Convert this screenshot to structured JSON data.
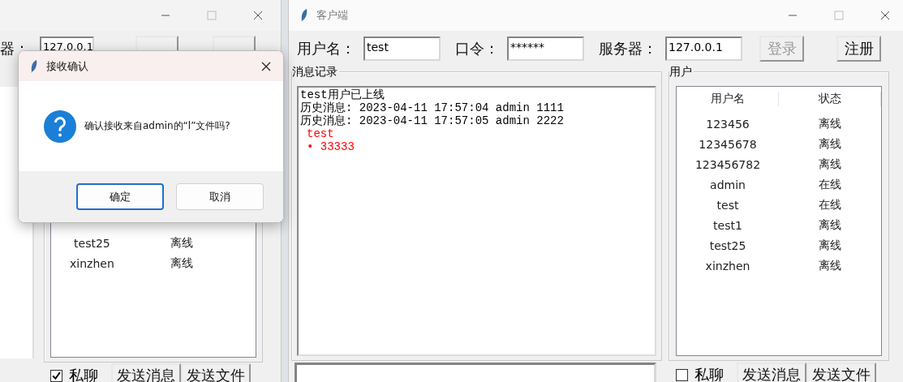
{
  "back_window": {
    "server_label": "器：",
    "server": "127.0.0.1",
    "users": [
      {
        "name": "test25",
        "status": "离线"
      },
      {
        "name": "xinzhen",
        "status": "离线"
      }
    ],
    "private_chat": {
      "label": "私聊",
      "checked": true
    },
    "send_buttons": [
      "发送消息",
      "发送文件"
    ]
  },
  "window": {
    "title": "客户端",
    "fields": [
      {
        "label": "用户名：",
        "value": "test"
      },
      {
        "label": "口令：",
        "value": "******"
      },
      {
        "label": "服务器：",
        "value": "127.0.0.1"
      }
    ],
    "buttons": [
      {
        "label": "登录",
        "disabled": true
      },
      {
        "label": "注册",
        "disabled": false
      }
    ],
    "messages": {
      "title": "消息记录",
      "lines": [
        {
          "text": "test用户已上线",
          "kind": "normal"
        },
        {
          "text": "历史消息: 2023-04-11 17:57:04 admin 1111",
          "kind": "normal"
        },
        {
          "text": "历史消息: 2023-04-11 17:57:05 admin 2222",
          "kind": "normal"
        },
        {
          "text": "test",
          "kind": "incoming"
        },
        {
          "text": "• 33333",
          "kind": "incoming"
        }
      ]
    },
    "users": {
      "title": "用户",
      "columns": [
        "用户名",
        "状态"
      ],
      "rows": [
        {
          "name": "123456",
          "status": "离线"
        },
        {
          "name": "12345678",
          "status": "离线"
        },
        {
          "name": "123456782",
          "status": "离线"
        },
        {
          "name": "admin",
          "status": "在线"
        },
        {
          "name": "test",
          "status": "在线"
        },
        {
          "name": "test1",
          "status": "离线"
        },
        {
          "name": "test25",
          "status": "离线"
        },
        {
          "name": "xinzhen",
          "status": "离线"
        }
      ]
    },
    "private_chat": {
      "label": "私聊",
      "checked": false
    },
    "send_buttons": [
      "发送消息",
      "发送文件"
    ]
  },
  "dialog": {
    "title": "接收确认",
    "message": "确认接收来自admin的“l”文件吗?",
    "buttons": [
      {
        "label": "确定",
        "focused": true
      },
      {
        "label": "取消",
        "focused": false
      }
    ]
  }
}
